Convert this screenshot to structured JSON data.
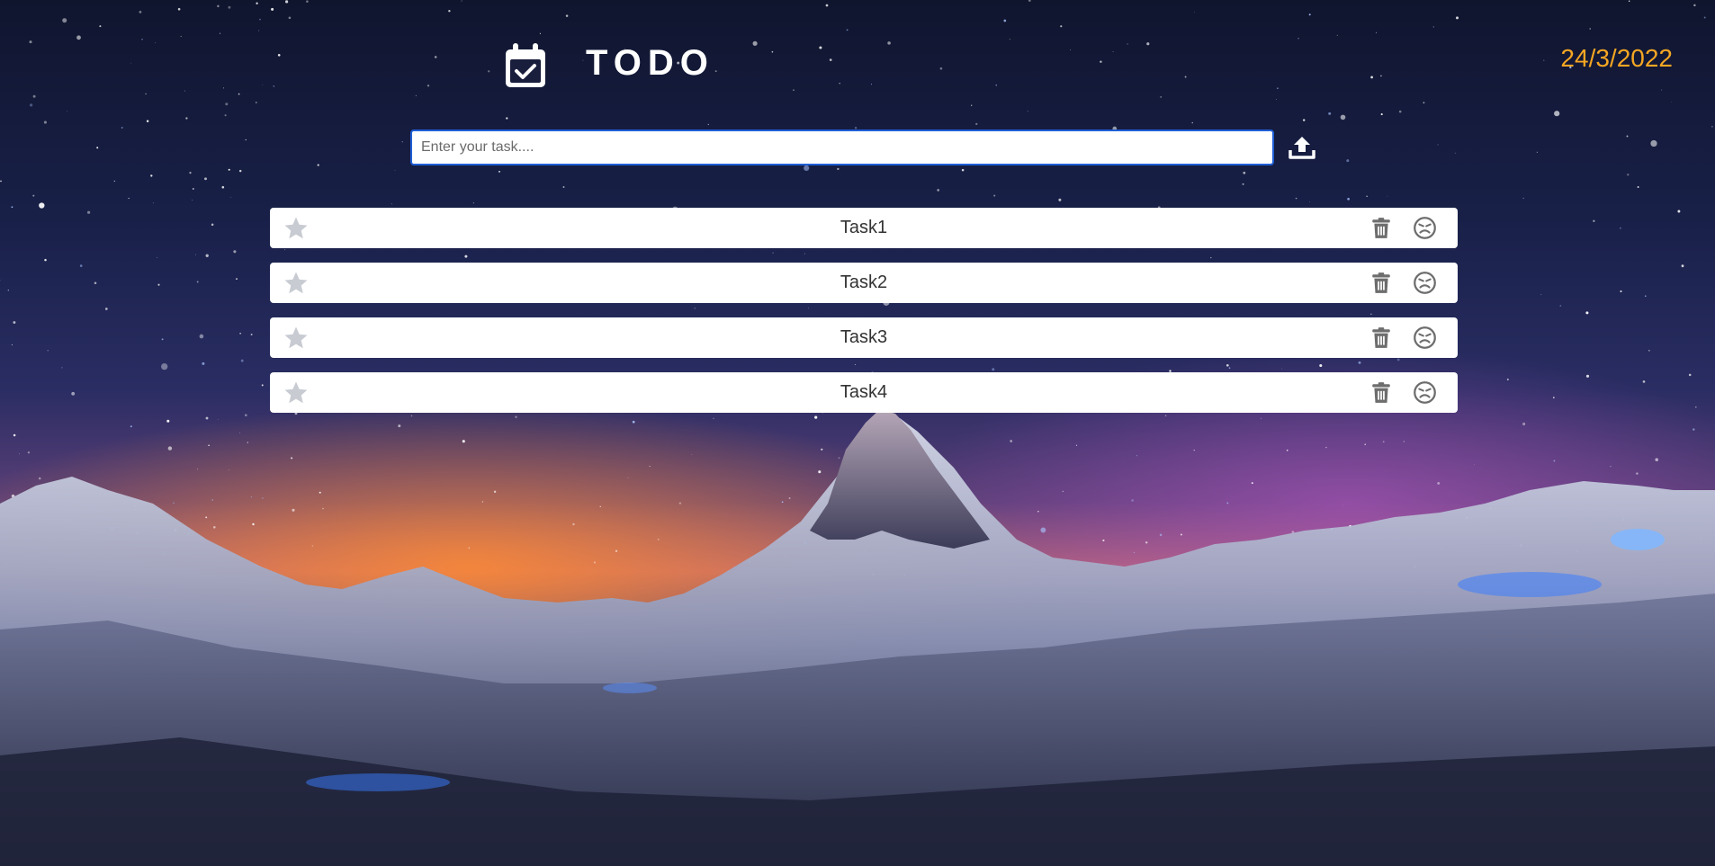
{
  "header": {
    "title": "TODO",
    "date": "24/3/2022",
    "icon": "calendar-check-icon"
  },
  "task_input": {
    "value": "",
    "placeholder": "Enter your task....",
    "submit_icon": "upload-icon"
  },
  "tasks": [
    {
      "label": "Task1"
    },
    {
      "label": "Task2"
    },
    {
      "label": "Task3"
    },
    {
      "label": "Task4"
    }
  ],
  "task_actions": {
    "star_icon": "star-icon",
    "delete_icon": "trash-icon",
    "mood_icon": "angry-face-icon"
  },
  "colors": {
    "date": "#f5a623",
    "title": "#ffffff",
    "input_border": "#1f5fd6",
    "row_background": "#ffffff",
    "icon_grey": "#6d6d6d",
    "star_grey": "#c8cbd2"
  }
}
